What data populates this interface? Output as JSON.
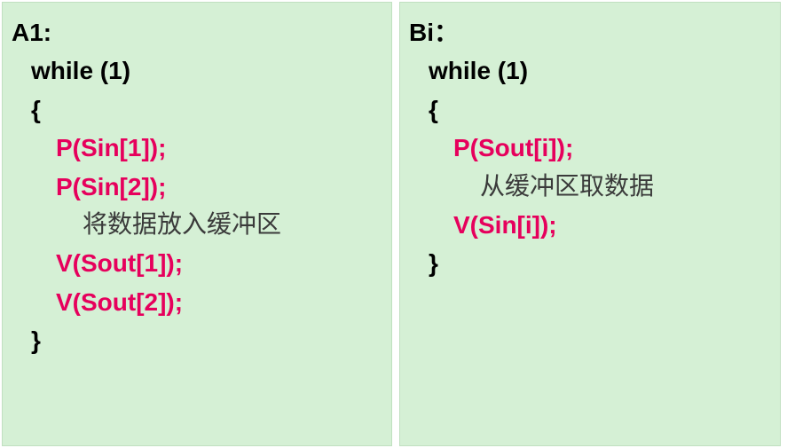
{
  "left": {
    "label": "A1:",
    "while": "while (1)",
    "lbrace": "{",
    "p1": "P(Sin[1]);",
    "p2": "P(Sin[2]);",
    "comment": "将数据放入缓冲区",
    "v1": "V(Sout[1]);",
    "v2": "V(Sout[2]);",
    "rbrace": "}"
  },
  "right": {
    "label": "Bi：",
    "while": "while (1)",
    "lbrace": "{",
    "p1": "P(Sout[i]);",
    "comment": "从缓冲区取数据",
    "v1": "V(Sin[i]);",
    "rbrace": "}"
  }
}
